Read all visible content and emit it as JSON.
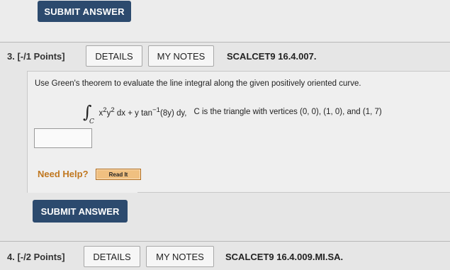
{
  "top": {
    "submit_label": "SUBMIT ANSWER"
  },
  "q3": {
    "number_label": "3.  [-/1 Points]",
    "details_label": "DETAILS",
    "notes_label": "MY NOTES",
    "code": "SCALCET9 16.4.007.",
    "prompt": "Use Green's theorem to evaluate the line integral along the given positively oriented curve.",
    "integral_symbol": "∫",
    "integral_sub": "C",
    "expression_html": "x<sup>2</sup>y<sup>2</sup> dx + y tan<sup>−1</sup>(8y) dy,",
    "condition": "C is the triangle with vertices (0, 0), (1, 0), and (1, 7)",
    "answer_value": "",
    "need_help": "Need Help?",
    "read_it": "Read It",
    "submit_label": "SUBMIT ANSWER"
  },
  "q4": {
    "number_label": "4.  [-/2 Points]",
    "details_label": "DETAILS",
    "notes_label": "MY NOTES",
    "code": "SCALCET9 16.4.009.MI.SA."
  },
  "colors": {
    "submit_bg": "#2c4a6e",
    "need_help": "#c0771f",
    "read_it_bg": "#f0c080"
  }
}
